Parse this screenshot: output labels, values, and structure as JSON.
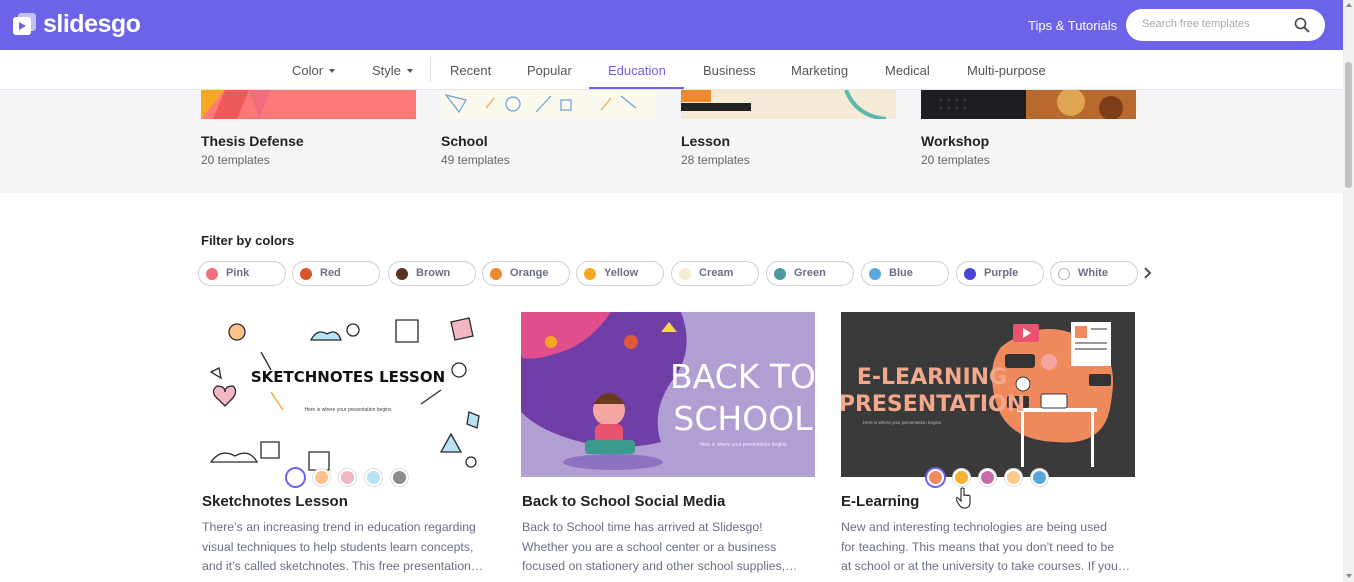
{
  "header": {
    "brand": "slidesgo",
    "tips_link": "Tips & Tutorials",
    "search_placeholder": "Search free templates",
    "brand_color": "#6c63e8"
  },
  "nav": {
    "color": "Color",
    "style": "Style",
    "tabs": [
      "Recent",
      "Popular",
      "Education",
      "Business",
      "Marketing",
      "Medical",
      "Multi-purpose"
    ],
    "active_tab": "Education"
  },
  "categories": [
    {
      "name": "Thesis Defense",
      "count": "20 templates"
    },
    {
      "name": "School",
      "count": "49 templates"
    },
    {
      "name": "Lesson",
      "count": "28 templates"
    },
    {
      "name": "Workshop",
      "count": "20 templates"
    }
  ],
  "filter": {
    "title": "Filter by colors",
    "colors": [
      {
        "label": "Pink",
        "hex": "#f26d7d"
      },
      {
        "label": "Red",
        "hex": "#d9552b"
      },
      {
        "label": "Brown",
        "hex": "#5a3222"
      },
      {
        "label": "Orange",
        "hex": "#ee8a2c"
      },
      {
        "label": "Yellow",
        "hex": "#f7a823"
      },
      {
        "label": "Cream",
        "hex": "#f6ecd2"
      },
      {
        "label": "Green",
        "hex": "#4f9a9f"
      },
      {
        "label": "Blue",
        "hex": "#5aa7dc"
      },
      {
        "label": "Purple",
        "hex": "#4a44d8"
      },
      {
        "label": "White",
        "hex": "#ffffff"
      }
    ]
  },
  "templates": [
    {
      "title": "Sketchnotes Lesson",
      "image_title": "SKETCHNOTES LESSON",
      "image_subtitle": "Here is where your presentation begins",
      "desc_lines": [
        "There’s an increasing trend in education regarding",
        "visual techniques to help students learn concepts,",
        "and it’s called sketchnotes. This free presentation…"
      ],
      "swatches": [
        "#ffffff",
        "#f9c38b",
        "#f2b6c4",
        "#b8e2f5",
        "#8e8e8e"
      ]
    },
    {
      "title": "Back to School Social Media",
      "image_title_1": "BACK TO",
      "image_title_2": "SCHOOL",
      "image_subtitle": "Here is where your presentation begins",
      "desc_lines": [
        "Back to School time has arrived at Slidesgo!",
        "Whether you are a school center or a business",
        "focused on stationery and other school supplies,…"
      ],
      "swatches": []
    },
    {
      "title": "E-Learning",
      "image_title_1": "E-LEARNING",
      "image_title_2": "PRESENTATION",
      "image_subtitle": "Here is where your presentation begins",
      "desc_lines": [
        "New and interesting technologies are being used",
        "for teaching. This means that you don’t need to be",
        "at school or at the university to take courses. If you…"
      ],
      "swatches": [
        "#f08a5d",
        "#f5b334",
        "#c86ca7",
        "#fcc98c",
        "#5aa7dc"
      ]
    }
  ]
}
